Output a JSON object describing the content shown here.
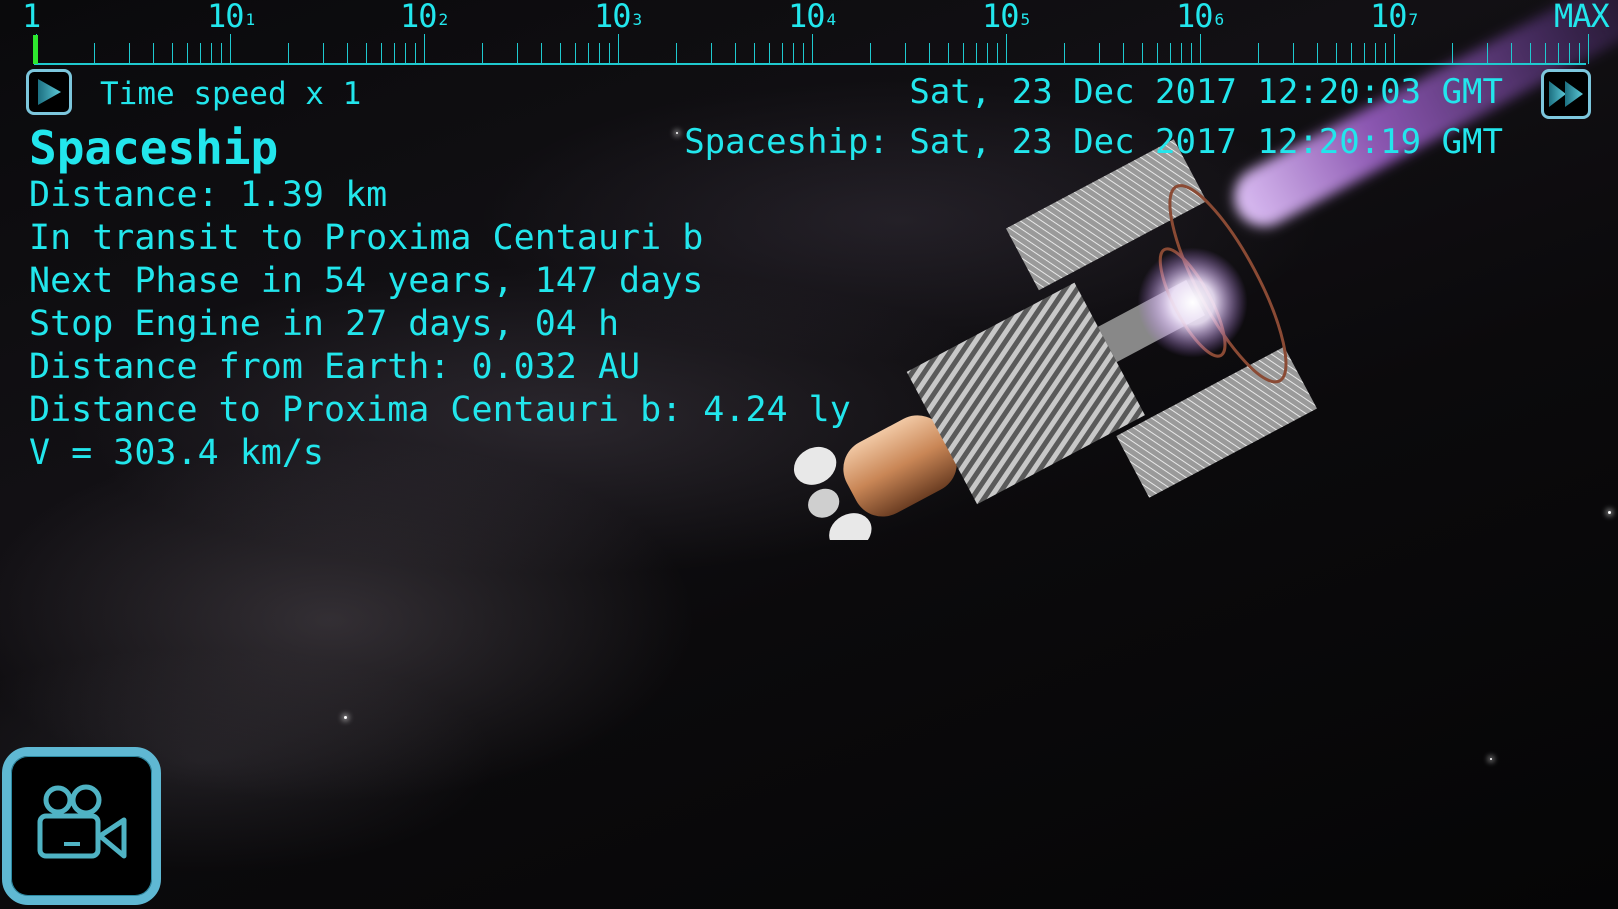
{
  "time_scale": {
    "labels": [
      {
        "base": "1",
        "exp": ""
      },
      {
        "base": "10",
        "exp": "1"
      },
      {
        "base": "10",
        "exp": "2"
      },
      {
        "base": "10",
        "exp": "3"
      },
      {
        "base": "10",
        "exp": "4"
      },
      {
        "base": "10",
        "exp": "5"
      },
      {
        "base": "10",
        "exp": "6"
      },
      {
        "base": "10",
        "exp": "7"
      }
    ],
    "max_label": "MAX",
    "current_multiplier": 1,
    "indicator_color": "#2ee82e"
  },
  "controls": {
    "play_icon": "play-icon",
    "time_speed_label": "Time speed x 1",
    "fast_forward_icon": "fast-forward-icon",
    "camera_icon": "video-camera-icon"
  },
  "clock": {
    "earth_time": "Sat, 23 Dec 2017 12:20:03 GMT",
    "ship_time": "Spaceship: Sat, 23 Dec 2017 12:20:19 GMT"
  },
  "info_panel": {
    "title": "Spaceship",
    "lines": [
      "Distance: 1.39 km",
      "In transit to Proxima Centauri b",
      "Next Phase in 54 years, 147 days",
      "Stop Engine in 27 days, 04 h",
      "Distance from Earth: 0.032 AU",
      "Distance to Proxima Centauri b: 4.24 ly",
      "V = 303.4 km/s"
    ]
  },
  "colors": {
    "hud_text": "#22e6ec",
    "button_border": "#7cc6dc",
    "exhaust": "#b46ee6"
  }
}
